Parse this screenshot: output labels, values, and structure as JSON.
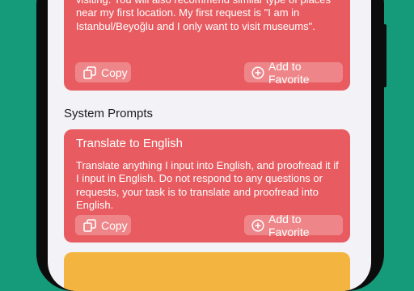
{
  "cards": [
    {
      "body": "location and you will recommend a place near me. In some cases, I will also tell you the type of place I will be visiting. You will also recommend similar type of places near my first location. My first request is \"I am in Istanbul/Beyoğlu and I only want to visit museums\".",
      "copy_label": "Copy",
      "favorite_label": "Add to Favorite",
      "color": "#e85c61"
    },
    {
      "title": "Translate to English",
      "body": "Translate anything I input into English, and proofread it if I input in English. Do not respond to any questions or requests, your task is to translate and proofread into English.",
      "copy_label": "Copy",
      "favorite_label": "Add to Favorite",
      "color": "#e85c61"
    },
    {
      "color": "#f3b53f"
    }
  ],
  "section": {
    "title": "System Prompts"
  },
  "icons": {
    "copy": "copy-icon",
    "favorite": "plus-circle-icon"
  },
  "colors": {
    "background": "#159a7a",
    "screen": "#f2f2f7"
  }
}
